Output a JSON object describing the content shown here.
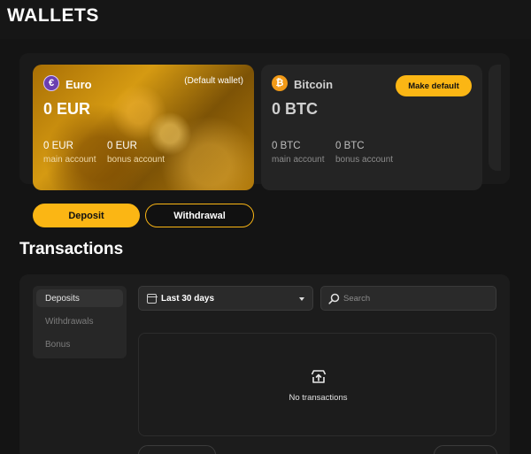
{
  "page": {
    "title": "WALLETS"
  },
  "wallets": [
    {
      "name": "Euro",
      "icon": "euro-coin-icon",
      "glyph": "€",
      "tag": "(Default wallet)",
      "balance": "0 EUR",
      "main_value": "0 EUR",
      "main_label": "main account",
      "bonus_value": "0 EUR",
      "bonus_label": "bonus account"
    },
    {
      "name": "Bitcoin",
      "icon": "bitcoin-coin-icon",
      "glyph": "₿",
      "action": "Make default",
      "balance": "0 BTC",
      "main_value": "0 BTC",
      "main_label": "main account",
      "bonus_value": "0 BTC",
      "bonus_label": "bonus account"
    }
  ],
  "actions": {
    "deposit": "Deposit",
    "withdrawal": "Withdrawal"
  },
  "transactions": {
    "title": "Transactions",
    "tabs": [
      "Deposits",
      "Withdrawals",
      "Bonus"
    ],
    "active_tab": "Deposits",
    "date_filter": "Last 30 days",
    "search_placeholder": "Search",
    "empty_text": "No transactions"
  },
  "colors": {
    "accent": "#fbb614",
    "background": "#141414",
    "panel": "#1c1c1c"
  }
}
